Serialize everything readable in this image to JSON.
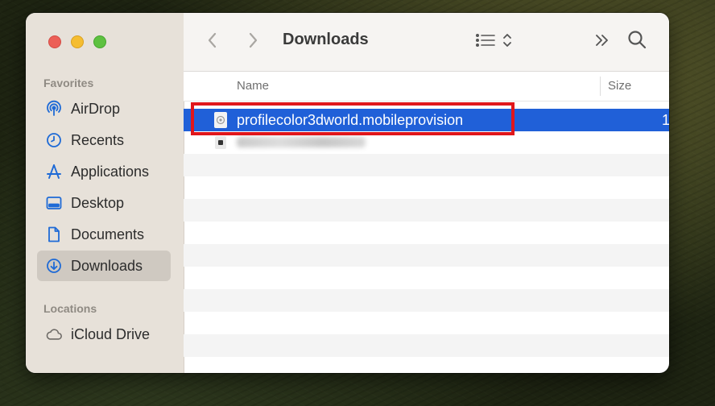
{
  "window": {
    "title": "Downloads"
  },
  "sidebar": {
    "sections": [
      {
        "label": "Favorites"
      },
      {
        "label": "Locations"
      }
    ],
    "favorites": [
      {
        "label": "AirDrop",
        "icon": "airdrop-icon"
      },
      {
        "label": "Recents",
        "icon": "clock-icon"
      },
      {
        "label": "Applications",
        "icon": "applications-icon"
      },
      {
        "label": "Desktop",
        "icon": "desktop-icon"
      },
      {
        "label": "Documents",
        "icon": "document-icon"
      },
      {
        "label": "Downloads",
        "icon": "download-icon",
        "selected": true
      }
    ],
    "locations": [
      {
        "label": "iCloud Drive",
        "icon": "cloud-icon"
      }
    ]
  },
  "toolbar": {
    "back": "back-chevron-icon",
    "forward": "forward-chevron-icon",
    "view_options": "list-view-icon",
    "more": "double-chevron-icon",
    "search": "search-icon"
  },
  "columns": {
    "name": "Name",
    "size": "Size"
  },
  "files": [
    {
      "name": "profilecolor3dworld.mobileprovision",
      "size": "1",
      "selected": true,
      "icon": "mobileprovision-file-icon"
    },
    {
      "name": "",
      "blurred": true,
      "icon": "app-file-icon"
    }
  ],
  "colors": {
    "selection": "#2060d8",
    "highlight_box": "#e0161b",
    "sidebar_bg": "#e7e1d9",
    "accent_icon": "#1e6ad6"
  }
}
